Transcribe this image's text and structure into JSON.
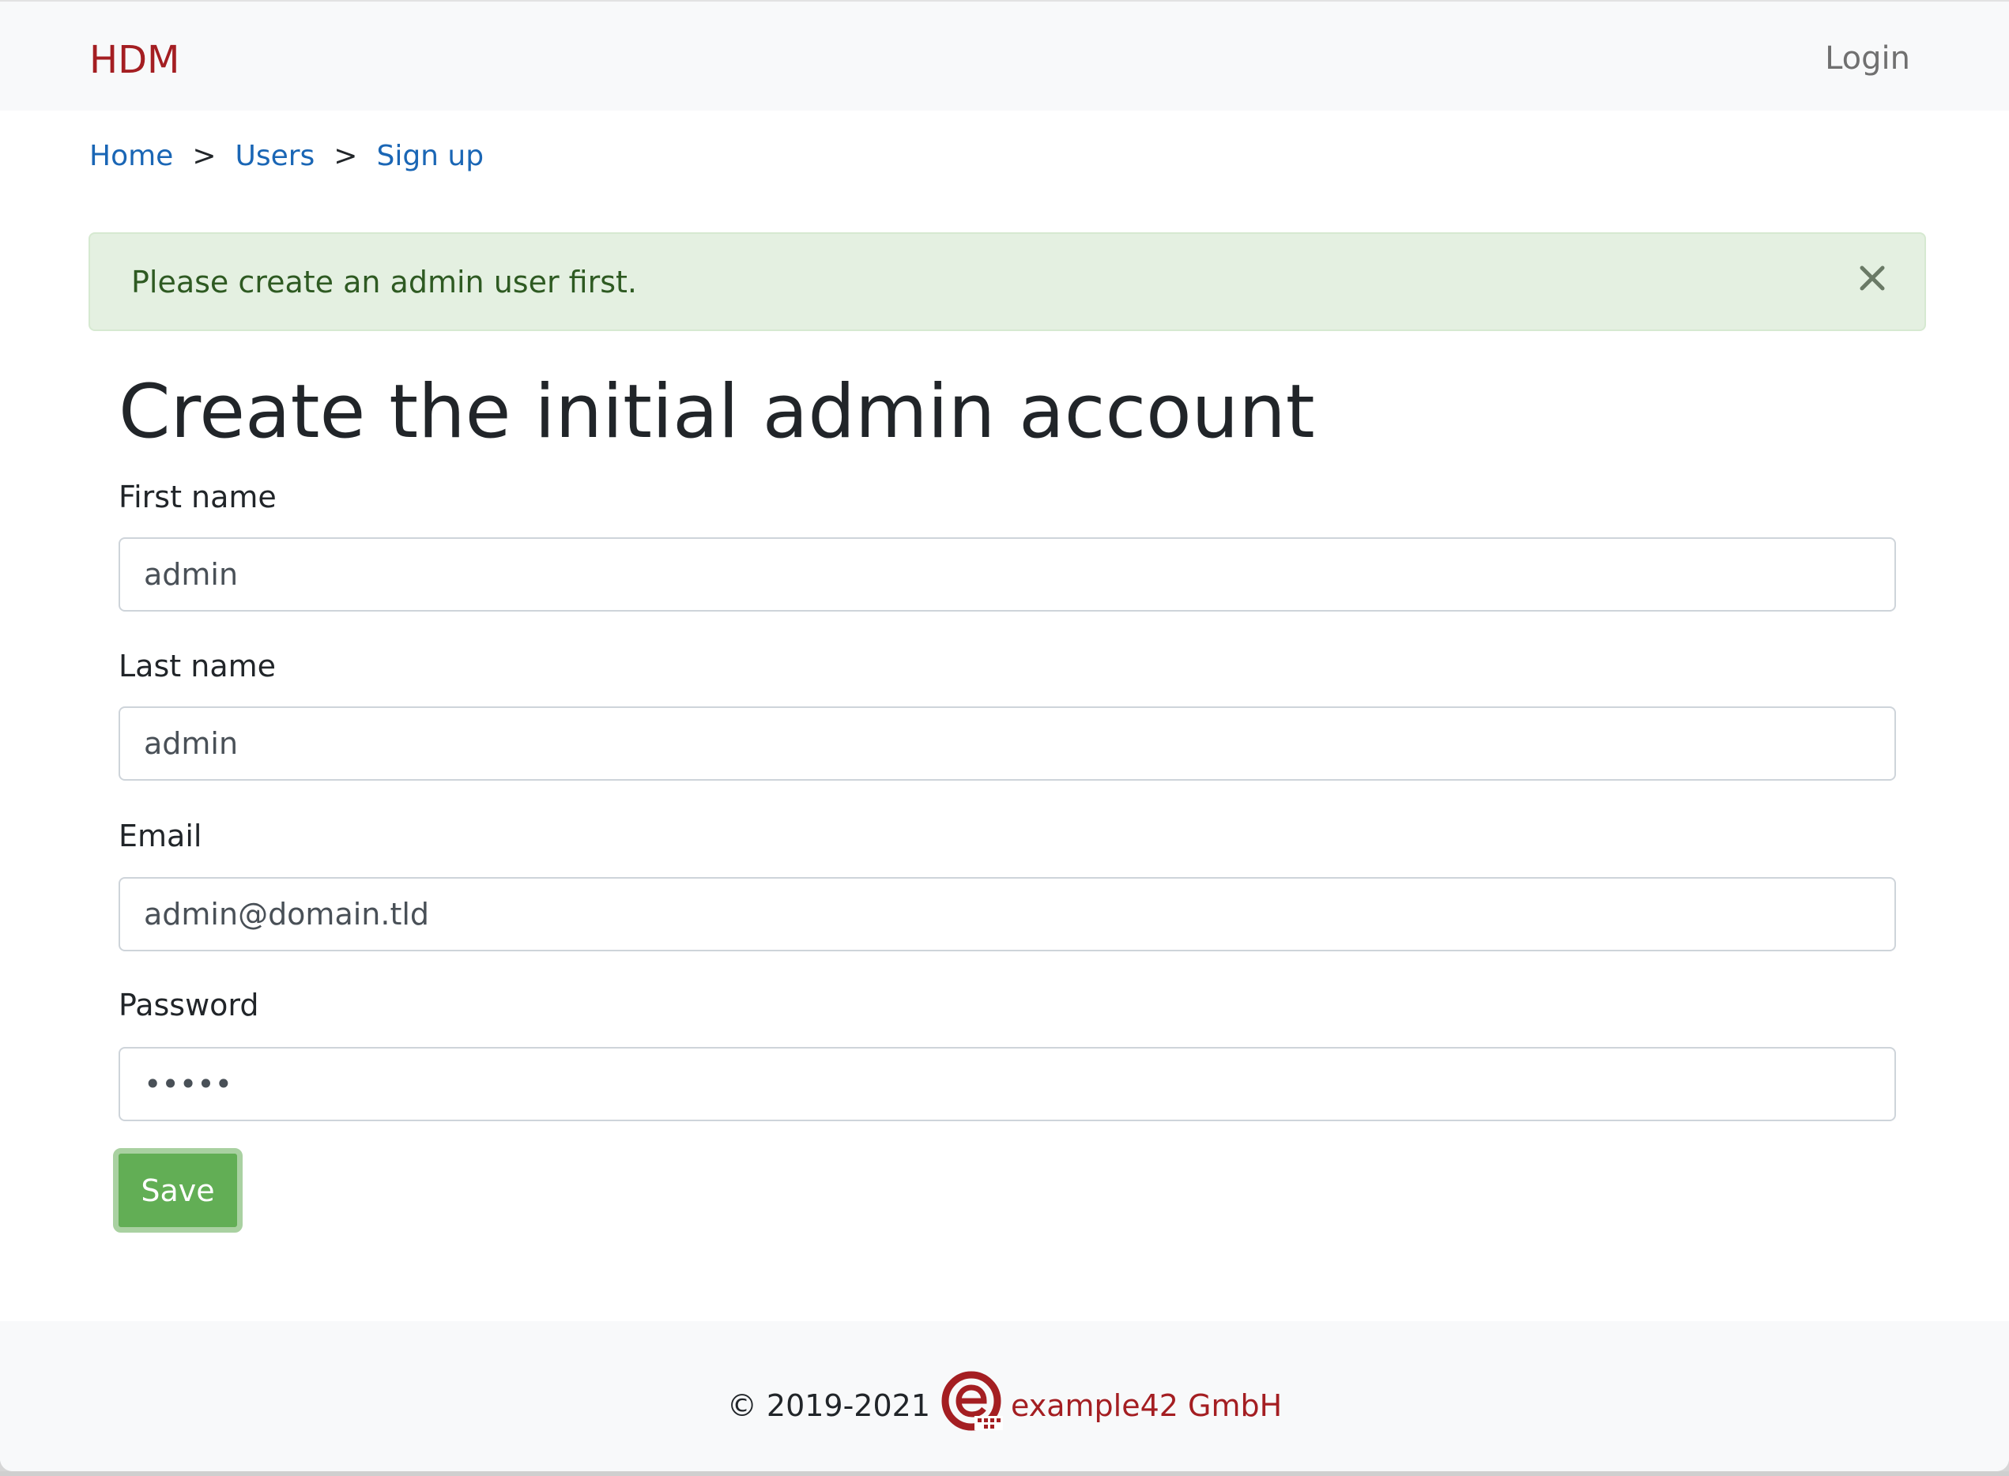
{
  "navbar": {
    "brand": "HDM",
    "login_label": "Login"
  },
  "breadcrumb": {
    "items": [
      "Home",
      "Users",
      "Sign up"
    ],
    "separator": ">"
  },
  "alert": {
    "message": "Please create an admin user first.",
    "close_icon": "close-icon"
  },
  "form": {
    "title": "Create the initial admin account",
    "fields": [
      {
        "label": "First name",
        "value": "admin",
        "type": "text"
      },
      {
        "label": "Last name",
        "value": "admin",
        "type": "text"
      },
      {
        "label": "Email",
        "value": "admin@domain.tld",
        "type": "email"
      },
      {
        "label": "Password",
        "value": "admin",
        "type": "password"
      }
    ],
    "save_label": "Save"
  },
  "footer": {
    "copyright": "© 2019-2021",
    "company": "example42 GmbH",
    "logo_icon": "example42-logo"
  },
  "colors": {
    "brand": "#a41e22",
    "link": "#1a66b5",
    "alert_bg": "#e4f0e1",
    "alert_text": "#2e5a22",
    "save_button": "#62ae55"
  }
}
